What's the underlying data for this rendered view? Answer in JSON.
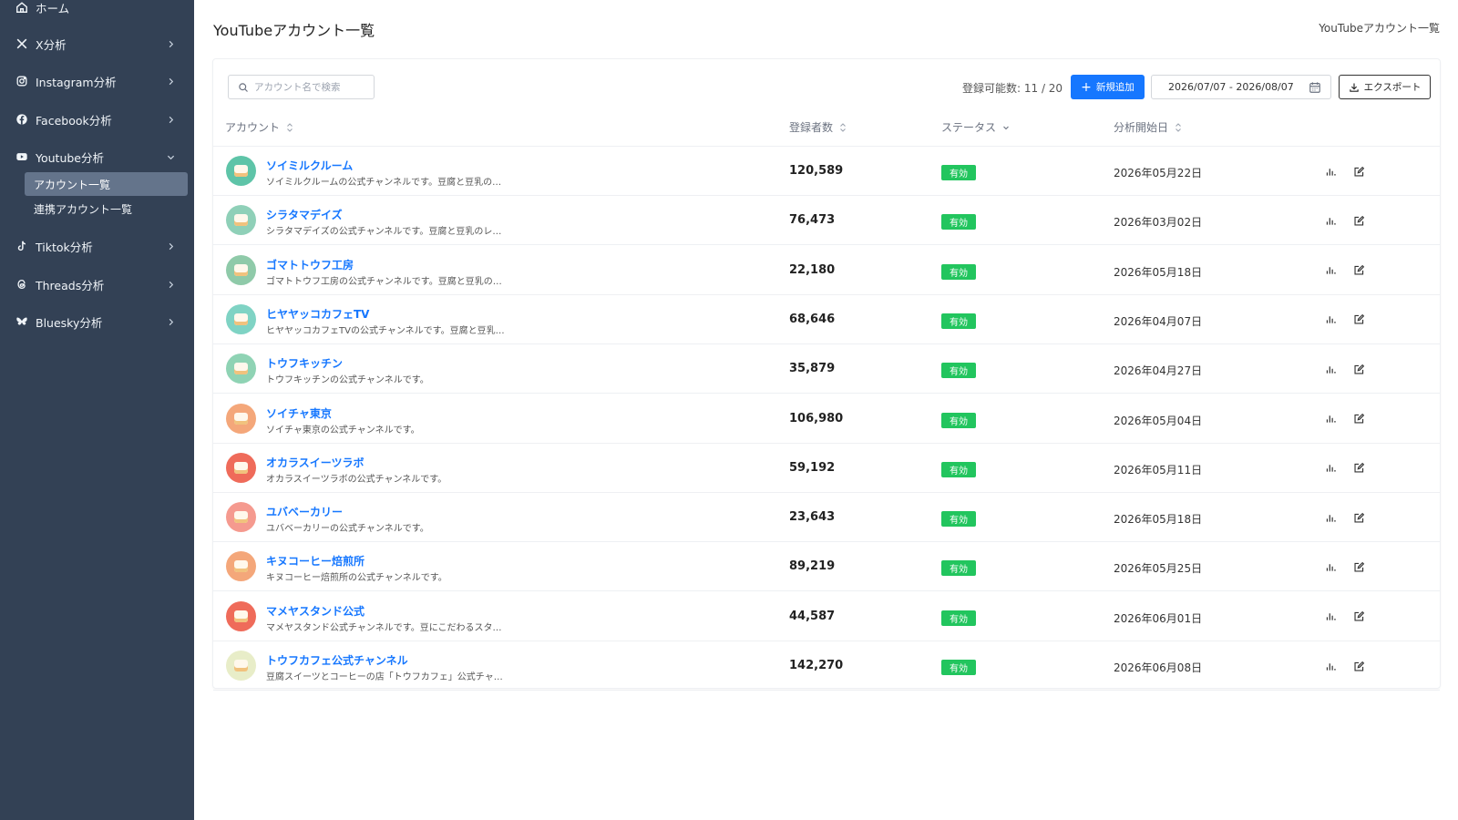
{
  "sidebar": {
    "items": [
      {
        "label": "ホーム",
        "icon": "home-icon"
      },
      {
        "label": "X分析",
        "icon": "x-logo-icon"
      },
      {
        "label": "Instagram分析",
        "icon": "instagram-icon"
      },
      {
        "label": "Facebook分析",
        "icon": "facebook-icon"
      },
      {
        "label": "Youtube分析",
        "icon": "youtube-icon"
      },
      {
        "label": "Tiktok分析",
        "icon": "tiktok-icon"
      },
      {
        "label": "Threads分析",
        "icon": "threads-icon"
      },
      {
        "label": "Bluesky分析",
        "icon": "bluesky-icon"
      }
    ],
    "youtube_sub": [
      {
        "label": "アカウント一覧",
        "active": true
      },
      {
        "label": "連携アカウント一覧",
        "active": false
      }
    ]
  },
  "header": {
    "title": "YouTubeアカウント一覧",
    "breadcrumb": "YouTubeアカウント一覧"
  },
  "toolbar": {
    "search_placeholder": "アカウント名で検索",
    "quota": "登録可能数: 11 / 20",
    "add_label": "新規追加",
    "date_range": "2026/07/07 - 2026/08/07",
    "export_label": "エクスポート"
  },
  "table": {
    "headers": {
      "account": "アカウント",
      "subscribers": "登録者数",
      "status": "ステータス",
      "start_date": "分析開始日"
    },
    "rows": [
      {
        "name": "ソイミルクルーム",
        "desc": "ソイミルクルームの公式チャンネルです。豆腐と豆乳の…",
        "subs": "120,589",
        "status": "有効",
        "date": "2026年05月22日",
        "avatar_color": "#5ec4a8"
      },
      {
        "name": "シラタマデイズ",
        "desc": "シラタマデイズの公式チャンネルです。豆腐と豆乳のレ…",
        "subs": "76,473",
        "status": "有効",
        "date": "2026年03月02日",
        "avatar_color": "#8fd0b8"
      },
      {
        "name": "ゴマトトウフ工房",
        "desc": "ゴマトトウフ工房の公式チャンネルです。豆腐と豆乳の…",
        "subs": "22,180",
        "status": "有効",
        "date": "2026年05月18日",
        "avatar_color": "#8fcaa9"
      },
      {
        "name": "ヒヤヤッコカフェTV",
        "desc": "ヒヤヤッコカフェTVの公式チャンネルです。豆腐と豆乳…",
        "subs": "68,646",
        "status": "有効",
        "date": "2026年04月07日",
        "avatar_color": "#7fd3c4"
      },
      {
        "name": "トウフキッチン",
        "desc": "トウフキッチンの公式チャンネルです。",
        "subs": "35,879",
        "status": "有効",
        "date": "2026年04月27日",
        "avatar_color": "#8fd3b4"
      },
      {
        "name": "ソイチャ東京",
        "desc": "ソイチャ東京の公式チャンネルです。",
        "subs": "106,980",
        "status": "有効",
        "date": "2026年05月04日",
        "avatar_color": "#f4a77a"
      },
      {
        "name": "オカラスイーツラボ",
        "desc": "オカラスイーツラボの公式チャンネルです。",
        "subs": "59,192",
        "status": "有効",
        "date": "2026年05月11日",
        "avatar_color": "#ef6b5a"
      },
      {
        "name": "ユバベーカリー",
        "desc": "ユバベーカリーの公式チャンネルです。",
        "subs": "23,643",
        "status": "有効",
        "date": "2026年05月18日",
        "avatar_color": "#f59a8f"
      },
      {
        "name": "キヌコーヒー焙煎所",
        "desc": "キヌコーヒー焙煎所の公式チャンネルです。",
        "subs": "89,219",
        "status": "有効",
        "date": "2026年05月25日",
        "avatar_color": "#f4a77a"
      },
      {
        "name": "マメヤスタンド公式",
        "desc": "マメヤスタンド公式チャンネルです。豆にこだわるスタ…",
        "subs": "44,587",
        "status": "有効",
        "date": "2026年06月01日",
        "avatar_color": "#ef6b5a"
      },
      {
        "name": "トウフカフェ公式チャンネル",
        "desc": "豆腐スイーツとコーヒーの店「トウフカフェ」公式チャ…",
        "subs": "142,270",
        "status": "有効",
        "date": "2026年06月08日",
        "avatar_color": "#e8edc8"
      }
    ]
  },
  "colors": {
    "sidebar_bg": "#334155",
    "primary": "#1677ff",
    "badge_green": "#22c55e"
  }
}
